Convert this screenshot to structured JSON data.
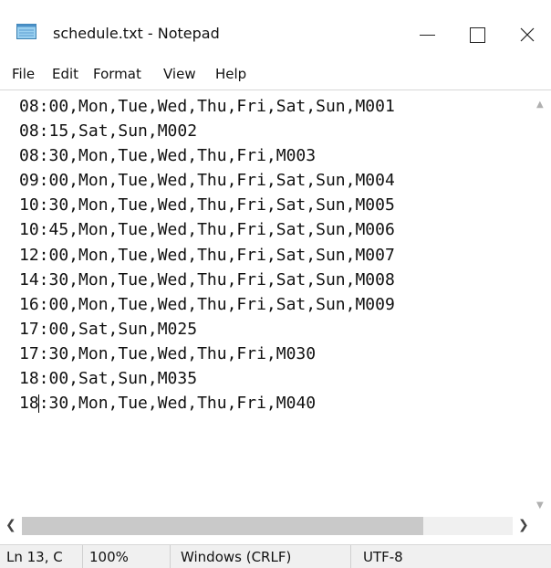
{
  "window": {
    "title": "schedule.txt - Notepad",
    "controls": {
      "minimize": "—",
      "maximize": "☐",
      "close": "✕"
    }
  },
  "menu": [
    "File",
    "Edit",
    "Format",
    "View",
    "Help"
  ],
  "editor": {
    "lines": [
      "08:00,Mon,Tue,Wed,Thu,Fri,Sat,Sun,M001",
      "08:15,Sat,Sun,M002",
      "08:30,Mon,Tue,Wed,Thu,Fri,M003",
      "09:00,Mon,Tue,Wed,Thu,Fri,Sat,Sun,M004",
      "10:30,Mon,Tue,Wed,Thu,Fri,Sat,Sun,M005",
      "10:45,Mon,Tue,Wed,Thu,Fri,Sat,Sun,M006",
      "12:00,Mon,Tue,Wed,Thu,Fri,Sat,Sun,M007",
      "14:30,Mon,Tue,Wed,Thu,Fri,Sat,Sun,M008",
      "16:00,Mon,Tue,Wed,Thu,Fri,Sat,Sun,M009",
      "17:00,Sat,Sun,M025",
      "17:30,Mon,Tue,Wed,Thu,Fri,M030",
      "18:00,Sat,Sun,M035"
    ],
    "caret_line_before": "18",
    "caret_line_after": ":30,Mon,Tue,Wed,Thu,Fri,M040"
  },
  "statusbar": {
    "position": "Ln 13, C",
    "zoom": "100%",
    "line_ending": "Windows (CRLF)",
    "encoding": "UTF-8"
  },
  "icons": {
    "app": "notepad-icon",
    "scroll_up": "chevron-up-icon",
    "scroll_down": "chevron-down-icon",
    "scroll_left": "chevron-left-icon",
    "scroll_right": "chevron-right-icon"
  }
}
